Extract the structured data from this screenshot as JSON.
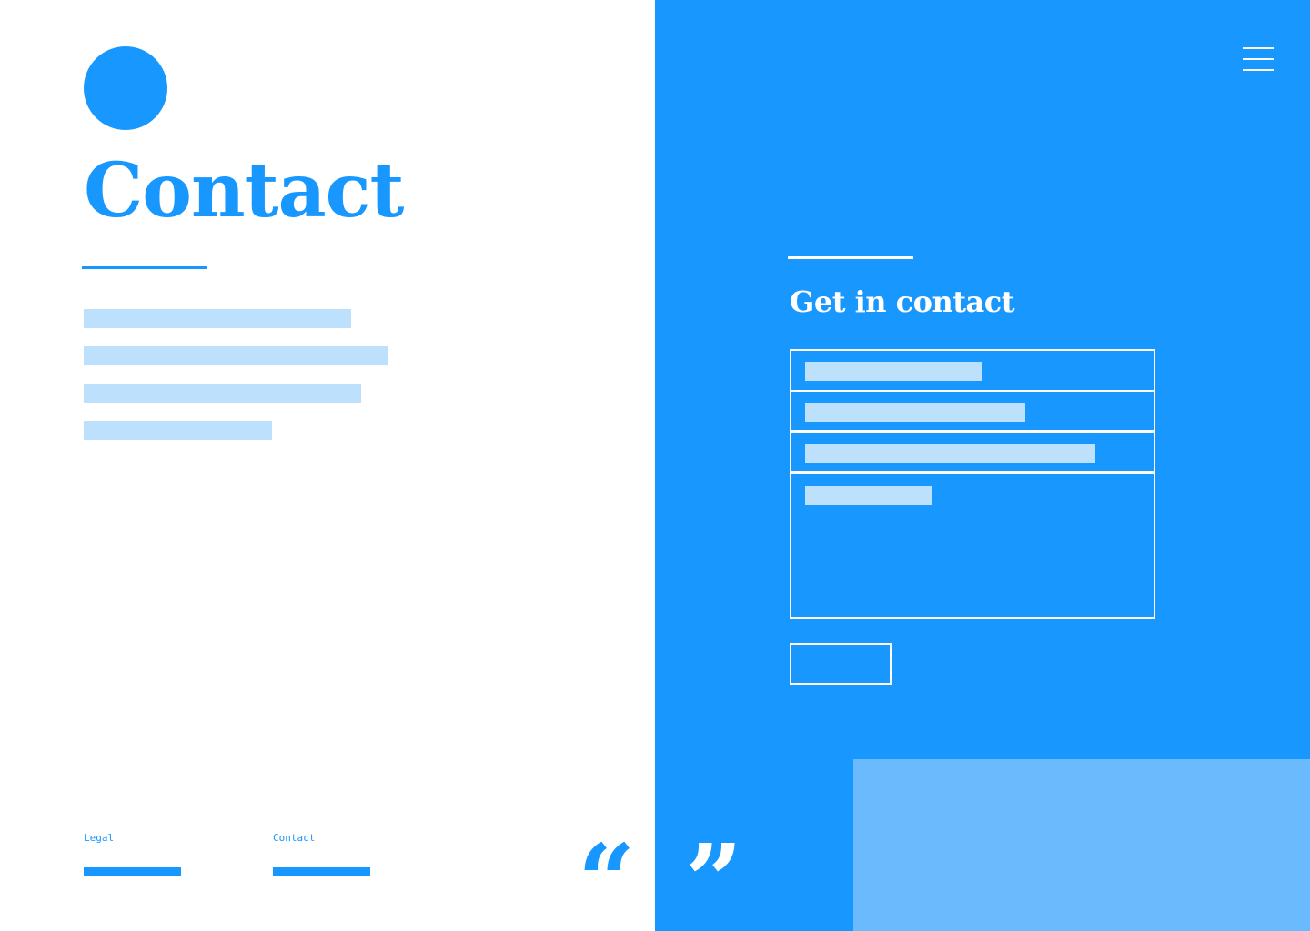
{
  "header": {
    "title": "Contact",
    "menu_icon": "hamburger-menu-icon",
    "logo_icon": "logo-circle-icon"
  },
  "contact_section": {
    "heading": "Get in contact",
    "submit_label": ""
  },
  "footer": {
    "links": [
      {
        "label": "Legal"
      },
      {
        "label": "Contact"
      }
    ]
  },
  "decorations": {
    "open_quote": "“",
    "close_quote": "”"
  },
  "colors": {
    "accent": "#1897ff",
    "placeholder": "#bde0fd",
    "light_accent": "#6bbafe",
    "background": "#ffffff"
  }
}
